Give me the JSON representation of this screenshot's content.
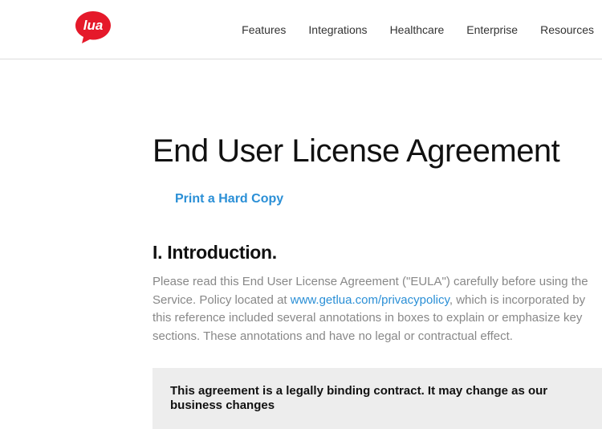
{
  "logo": {
    "text": "lua",
    "bg": "#e5192a",
    "fg": "#ffffff"
  },
  "nav": {
    "items": [
      {
        "label": "Features"
      },
      {
        "label": "Integrations"
      },
      {
        "label": "Healthcare"
      },
      {
        "label": "Enterprise"
      },
      {
        "label": "Resources"
      }
    ]
  },
  "page": {
    "title": "End User License Agreement",
    "print_label": "Print a Hard Copy",
    "section1": {
      "heading": "I. Introduction.",
      "para_before_link": "Please read this End User License Agreement (\"EULA\") carefully before using the Service. Policy located at ",
      "link_text": "www.getlua.com/privacypolicy",
      "para_after_link": ", which is incorporated by this reference included several annotations in boxes to explain or emphasize key sections. These annotations and have no legal or contractual effect.",
      "annotation": "This agreement is a legally binding contract. It may change as our business changes"
    }
  }
}
